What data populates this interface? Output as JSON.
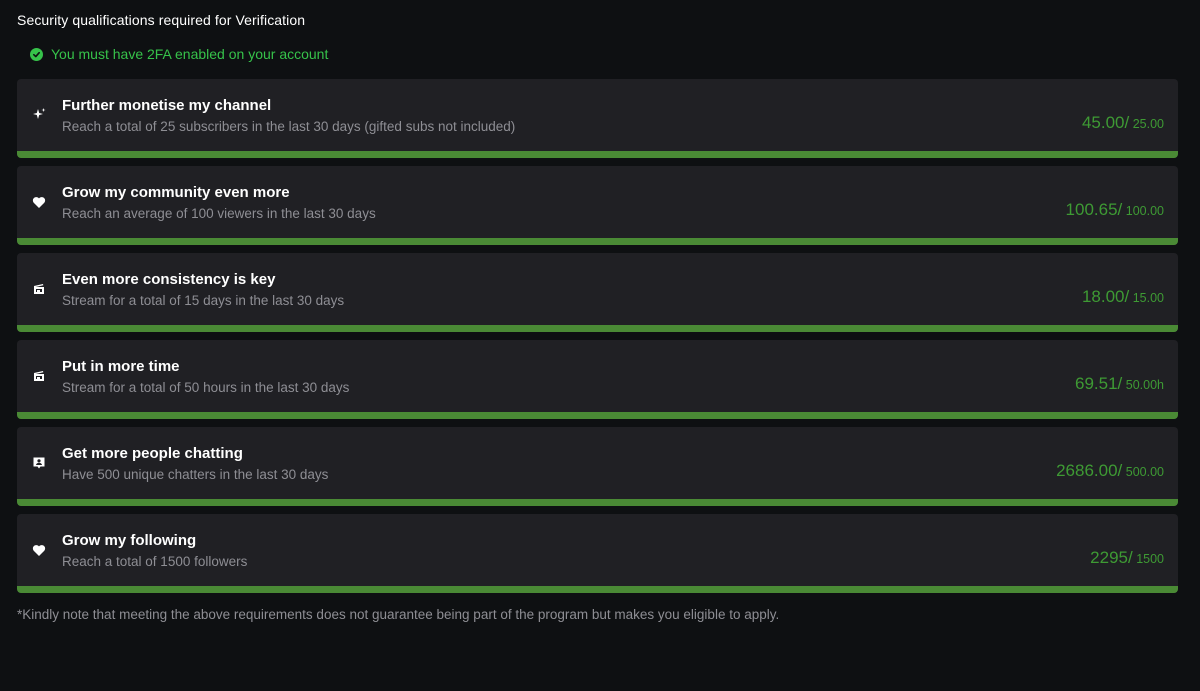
{
  "heading": "Security qualifications required for Verification",
  "twofa": {
    "label": "You must have 2FA enabled on your account",
    "status_icon": "check-circle-icon",
    "color": "#36c24a"
  },
  "accent": "#4a8a35",
  "cards": [
    {
      "icon": "sparkle-icon",
      "title": "Further monetise my channel",
      "desc": "Reach a total of 25 subscribers in the last 30 days (gifted subs not included)",
      "current": "45.00/",
      "required": " 25.00",
      "progress": 1
    },
    {
      "icon": "heart-icon",
      "title": "Grow my community even more",
      "desc": "Reach an average of 100 viewers in the last 30 days",
      "current": "100.65/",
      "required": " 100.00",
      "progress": 1
    },
    {
      "icon": "calendar-icon",
      "title": "Even more consistency is key",
      "desc": "Stream for a total of 15 days in the last 30 days",
      "current": "18.00/",
      "required": " 15.00",
      "progress": 1
    },
    {
      "icon": "calendar-icon",
      "title": "Put in more time",
      "desc": "Stream for a total of 50 hours in the last 30 days",
      "current": "69.51/",
      "required": " 50.00h",
      "progress": 1
    },
    {
      "icon": "chat-user-icon",
      "title": "Get more people chatting",
      "desc": "Have 500 unique chatters in the last 30 days",
      "current": "2686.00/",
      "required": " 500.00",
      "progress": 1
    },
    {
      "icon": "heart-icon",
      "title": "Grow my following",
      "desc": "Reach a total of 1500 followers",
      "current": "2295/",
      "required": " 1500",
      "progress": 1
    }
  ],
  "note": "*Kindly note that meeting the above requirements does not guarantee being part of the program but makes you eligible to apply."
}
